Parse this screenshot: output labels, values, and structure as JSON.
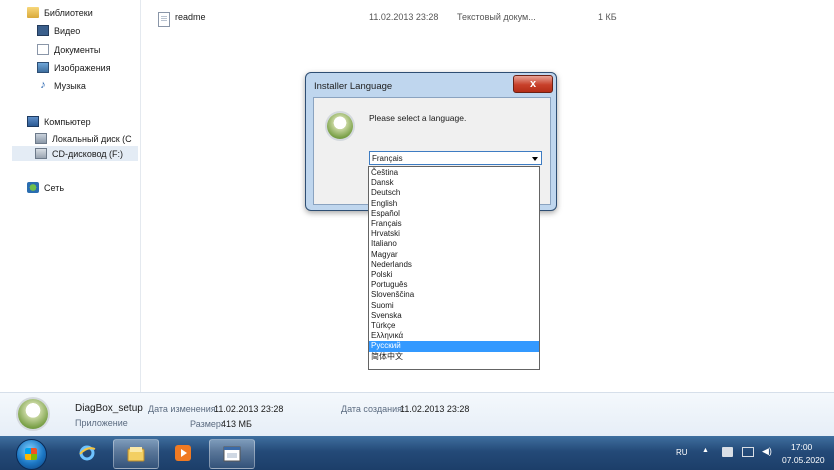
{
  "sidebar": {
    "items": [
      {
        "label": "Библиотеки",
        "icon": "libraries-icon"
      },
      {
        "label": "Видео",
        "icon": "video-icon"
      },
      {
        "label": "Документы",
        "icon": "documents-icon"
      },
      {
        "label": "Изображения",
        "icon": "pictures-icon"
      },
      {
        "label": "Музыка",
        "icon": "music-icon"
      },
      {
        "label": "Компьютер",
        "icon": "computer-icon"
      },
      {
        "label": "Локальный диск (C",
        "icon": "local-disk-icon"
      },
      {
        "label": "CD-дисковод (F:)",
        "icon": "cd-drive-icon",
        "selected": true
      },
      {
        "label": "Сеть",
        "icon": "network-icon"
      }
    ]
  },
  "file_list": {
    "row": {
      "name": "readme",
      "date": "11.02.2013 23:28",
      "type": "Текстовый докум...",
      "size": "1 КБ"
    }
  },
  "details": {
    "name": "DiagBox_setup",
    "kind": "Приложение",
    "modified_label": "Дата изменения:",
    "modified_value": "11.02.2013 23:28",
    "created_label": "Дата создания:",
    "created_value": "11.02.2013 23:28",
    "size_label": "Размер:",
    "size_value": "413 МБ"
  },
  "dialog": {
    "title": "Installer Language",
    "close_label": "x",
    "prompt": "Please select a language.",
    "selected": "Français",
    "options": [
      "Čeština",
      "Dansk",
      "Deutsch",
      "English",
      "Español",
      "Français",
      "Hrvatski",
      "Italiano",
      "Magyar",
      "Nederlands",
      "Polski",
      "Português",
      "Slovenščina",
      "Suomi",
      "Svenska",
      "Türkçe",
      "Ελληνικά",
      "Русский",
      "简体中文"
    ],
    "highlighted": "Русский"
  },
  "taskbar": {
    "buttons": [
      "start-button",
      "internet-explorer-icon",
      "explorer-folder-icon",
      "media-player-icon",
      "installer-window-icon"
    ],
    "language": "RU",
    "time": "17:00",
    "date": "07.05.2020"
  },
  "colors": {
    "taskbar": "#244a78",
    "dialog_frame": "#bfd6ee",
    "highlight": "#3399ff",
    "close_button": "#c8402a"
  }
}
